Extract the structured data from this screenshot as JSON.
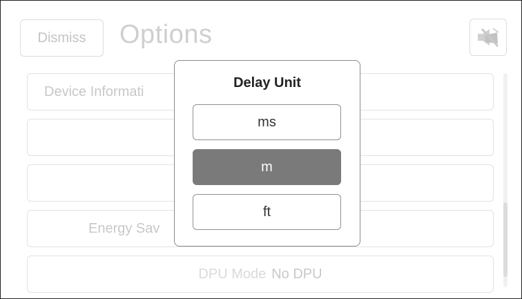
{
  "header": {
    "dismiss_label": "Dismiss",
    "title": "Options",
    "mute_icon": "speaker-muted-icon"
  },
  "rows": [
    {
      "label": "Device Informati"
    },
    {
      "label": ""
    },
    {
      "label": ""
    },
    {
      "label": "Energy Sav"
    },
    {
      "label": "DPU Mode",
      "value": "No DPU"
    }
  ],
  "dialog": {
    "title": "Delay Unit",
    "options": [
      {
        "label": "ms",
        "selected": false
      },
      {
        "label": "m",
        "selected": true
      },
      {
        "label": "ft",
        "selected": false
      }
    ]
  },
  "colors": {
    "selected_option": "#7a7a7a",
    "dialog_border": "#8a8a8a",
    "dimmed_text": "#c8c8c8"
  }
}
